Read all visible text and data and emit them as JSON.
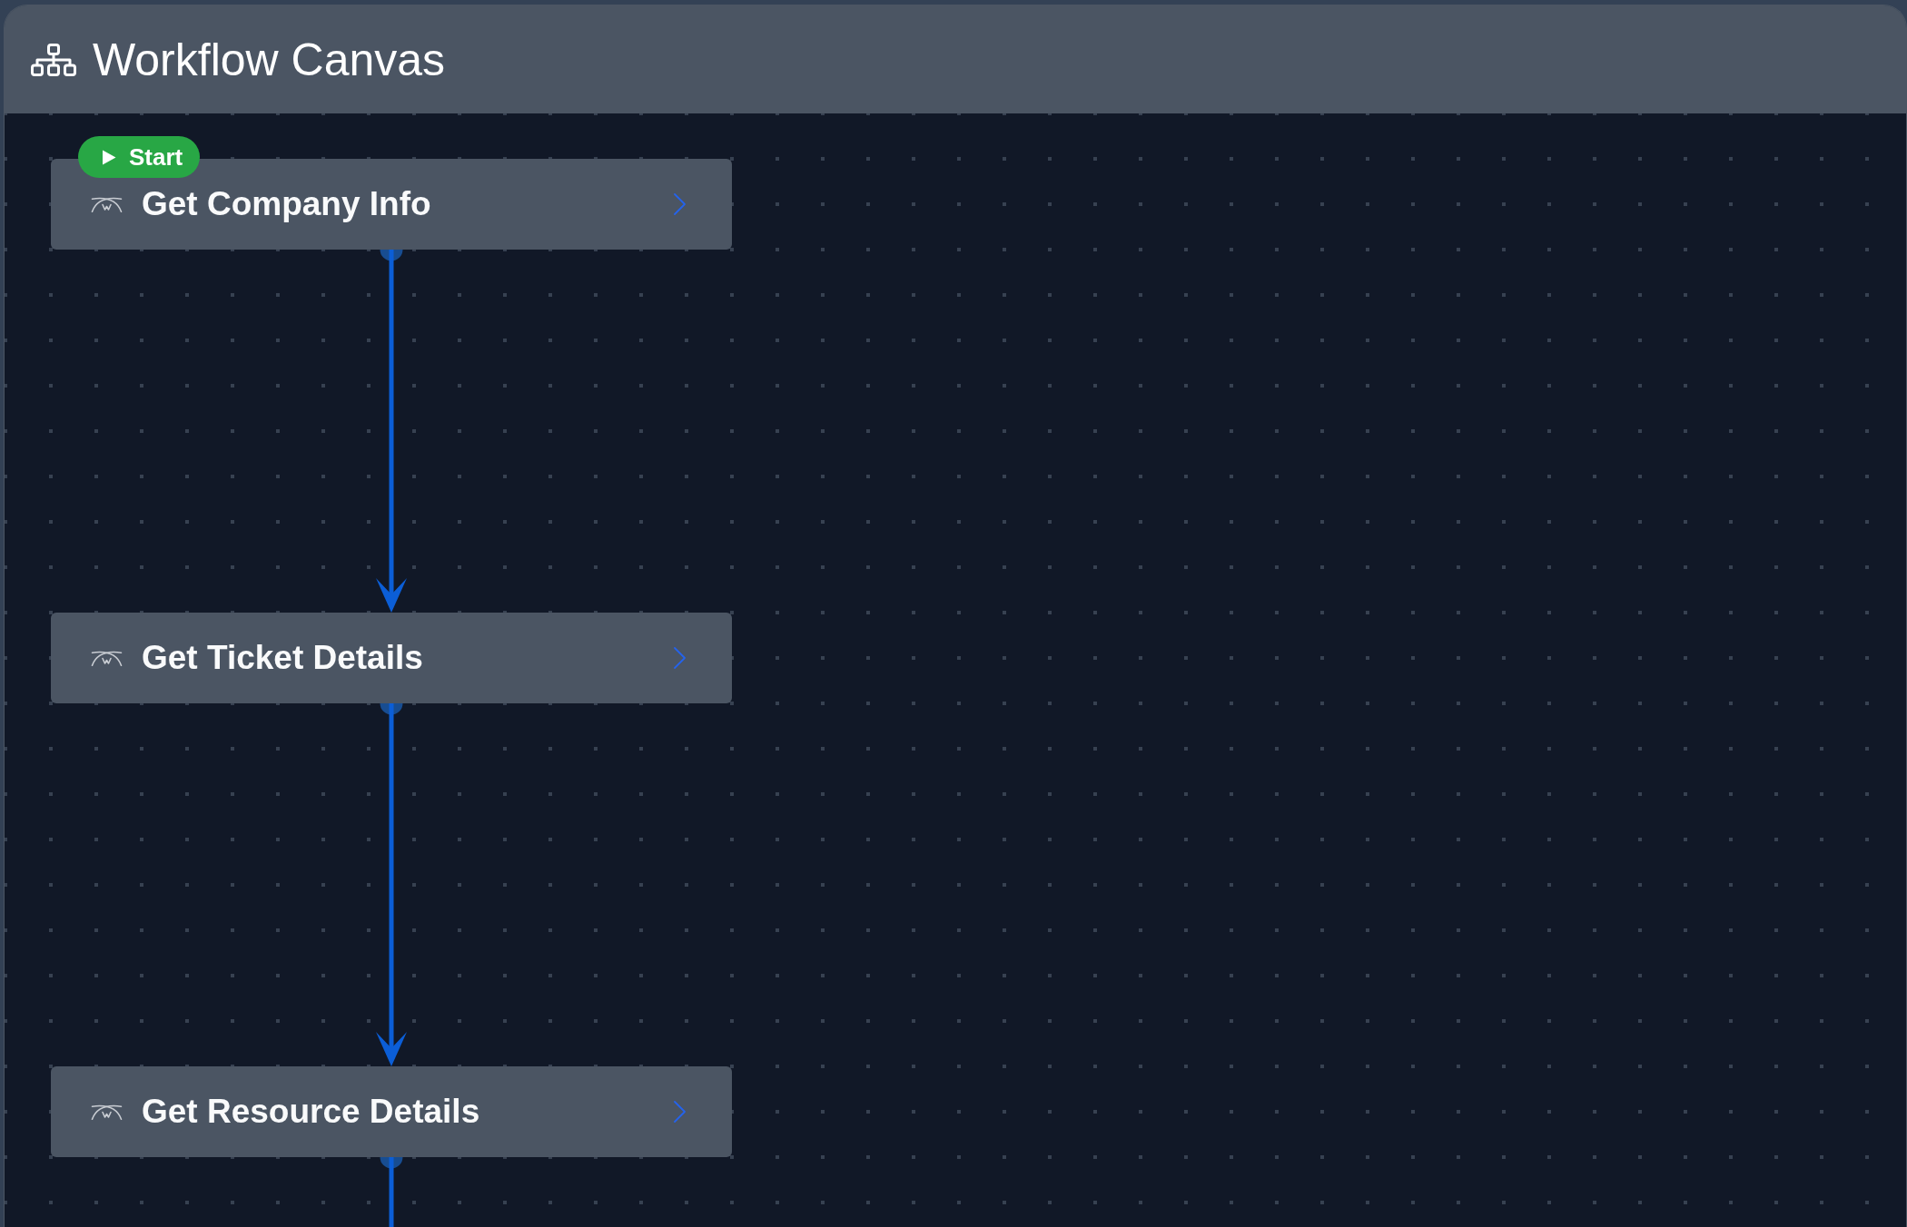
{
  "header": {
    "title": "Workflow Canvas"
  },
  "nodes": [
    {
      "title": "Get Company Info",
      "badge": {
        "kind": "start",
        "label": "Start"
      },
      "outgoing_link": true
    },
    {
      "title": "Get Ticket Details",
      "outgoing_link": true
    },
    {
      "title": "Get Resource Details",
      "outgoing_link": true
    }
  ]
}
